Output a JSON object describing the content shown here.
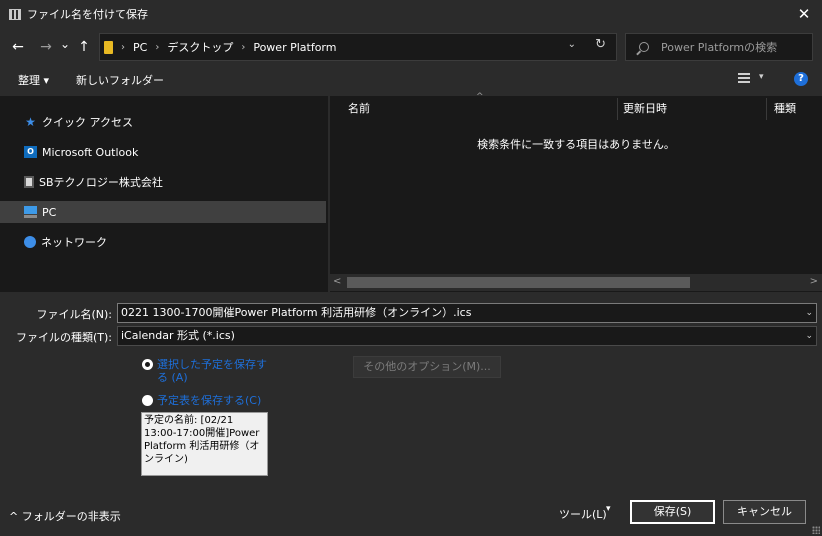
{
  "window": {
    "title": "ファイル名を付けて保存",
    "close_glyph": "✕"
  },
  "nav": {
    "back_glyph": "←",
    "forward_glyph": "→",
    "recent_glyph": "⌄",
    "up_glyph": "↑",
    "breadcrumbs": [
      "PC",
      "デスクトップ",
      "Power Platform"
    ],
    "crumb_sep": "›",
    "refresh_glyph": "↻",
    "dropdown_glyph": "⌄"
  },
  "search": {
    "placeholder": "Power Platformの検索"
  },
  "toolbar": {
    "organize_label": "整理 ▾",
    "new_folder_label": "新しいフォルダー",
    "view_caret": "▾",
    "help_label": "?"
  },
  "sidebar": {
    "items": [
      {
        "label": "クイック アクセス",
        "icon": "star-icon"
      },
      {
        "label": "Microsoft Outlook",
        "icon": "outlook-icon"
      },
      {
        "label": "SBテクノロジー株式会社",
        "icon": "building-icon"
      },
      {
        "label": "PC",
        "icon": "pc-icon",
        "selected": true
      },
      {
        "label": "ネットワーク",
        "icon": "network-icon"
      }
    ]
  },
  "file_list": {
    "columns": [
      "名前",
      "更新日時",
      "種類"
    ],
    "sort_glyph": "^",
    "empty_message": "検索条件に一致する項目はありません。",
    "scroll_left": "<",
    "scroll_right": ">"
  },
  "form": {
    "filename_label": "ファイル名(N):",
    "filename_value": "0221 1300-1700開催Power Platform 利活用研修（オンライン）.ics",
    "filetype_label": "ファイルの種類(T):",
    "filetype_value": "iCalendar 形式 (*.ics)",
    "combo_chev": "⌄",
    "radio_selected_label": "選択した予定を保存する (A)",
    "radio_calendar_label": "予定表を保存する(C)",
    "options_button": "その他のオプション(M)...",
    "preview_text": "予定の名前: [02/21 13:00-17:00開催]Power Platform 利活用研修（オンライン)"
  },
  "footer": {
    "hide_folders": "^ フォルダーの非表示",
    "tools_label": "ツール(L)",
    "tools_caret": "▾",
    "save_button": "保存(S)",
    "cancel_button": "キャンセル"
  }
}
